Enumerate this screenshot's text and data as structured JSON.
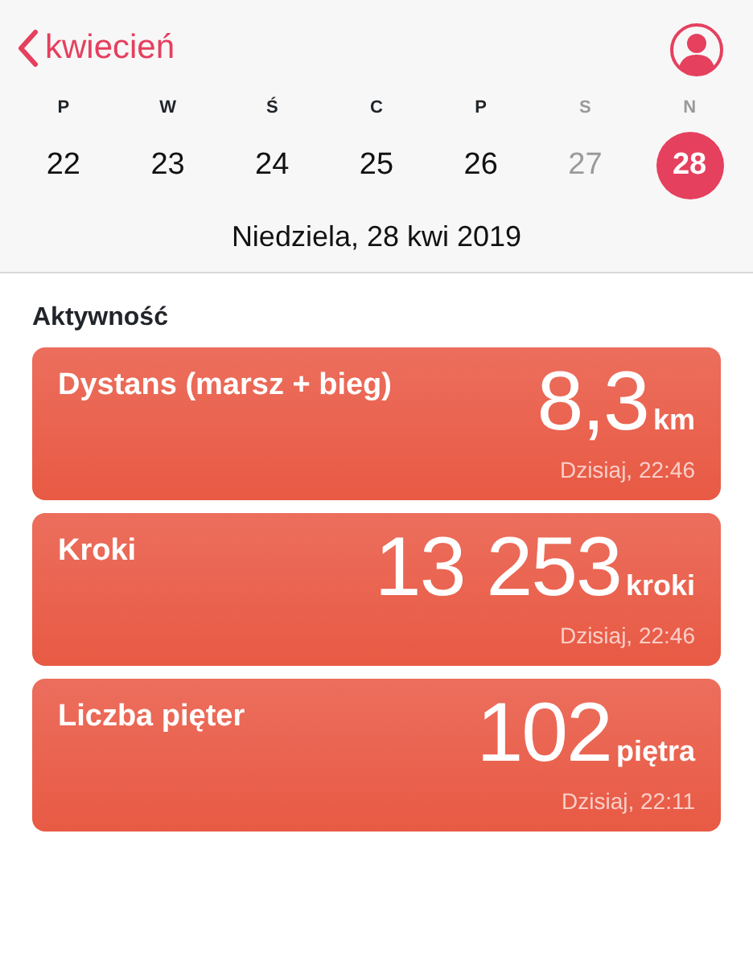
{
  "header": {
    "back_label": "kwiecień"
  },
  "week": [
    {
      "letter": "P",
      "day": "22",
      "dimmed": false,
      "selected": false
    },
    {
      "letter": "W",
      "day": "23",
      "dimmed": false,
      "selected": false
    },
    {
      "letter": "Ś",
      "day": "24",
      "dimmed": false,
      "selected": false
    },
    {
      "letter": "C",
      "day": "25",
      "dimmed": false,
      "selected": false
    },
    {
      "letter": "P",
      "day": "26",
      "dimmed": false,
      "selected": false
    },
    {
      "letter": "S",
      "day": "27",
      "dimmed": true,
      "selected": false
    },
    {
      "letter": "N",
      "day": "28",
      "dimmed": true,
      "selected": true
    }
  ],
  "date_line": "Niedziela, 28 kwi 2019",
  "section_title": "Aktywność",
  "cards": [
    {
      "title": "Dystans (marsz + bieg)",
      "value": "8,3",
      "unit": "km",
      "time": "Dzisiaj, 22:46"
    },
    {
      "title": "Kroki",
      "value": "13 253",
      "unit": "kroki",
      "time": "Dzisiaj, 22:46"
    },
    {
      "title": "Liczba pięter",
      "value": "102",
      "unit": "piętra",
      "time": "Dzisiaj, 22:11"
    }
  ]
}
